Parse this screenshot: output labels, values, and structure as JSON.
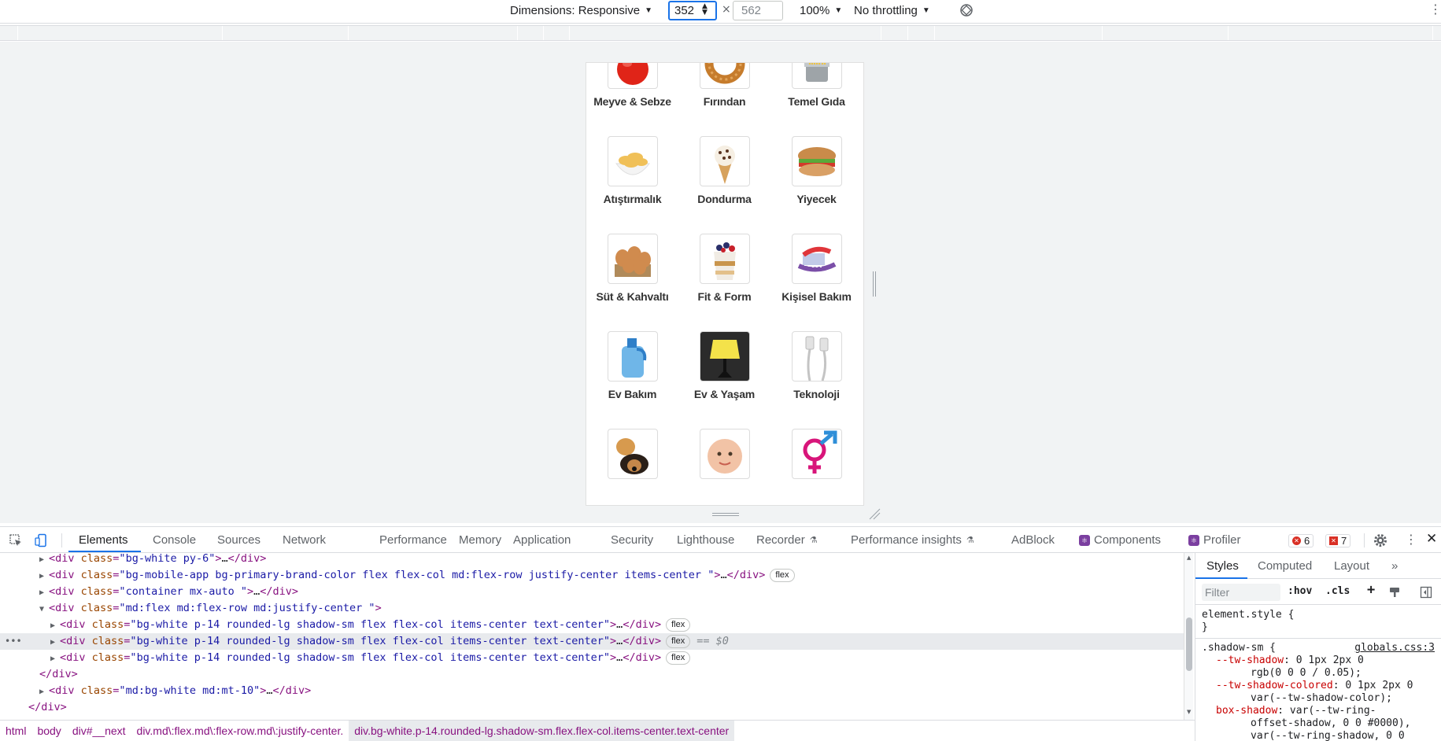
{
  "device_toolbar": {
    "dimensions_label": "Dimensions: Responsive",
    "width_value": "352",
    "times_sign": "×",
    "height_placeholder": "562",
    "zoom_label": "100%",
    "throttling_label": "No throttling",
    "dropdown_arrow": "▼",
    "more_icon": "⋮"
  },
  "categories": [
    {
      "label": "Meyve & Sebze",
      "icon": "tomato-icon"
    },
    {
      "label": "Fırından",
      "icon": "simit-icon"
    },
    {
      "label": "Temel Gıda",
      "icon": "pasta-icon"
    },
    {
      "label": "Atıştırmalık",
      "icon": "chips-icon"
    },
    {
      "label": "Dondurma",
      "icon": "ice-cream-icon"
    },
    {
      "label": "Yiyecek",
      "icon": "sandwich-icon"
    },
    {
      "label": "Süt & Kahvaltı",
      "icon": "eggs-icon"
    },
    {
      "label": "Fit & Form",
      "icon": "parfait-icon"
    },
    {
      "label": "Kişisel Bakım",
      "icon": "toothbrush-icon"
    },
    {
      "label": "Ev Bakım",
      "icon": "detergent-icon"
    },
    {
      "label": "Ev & Yaşam",
      "icon": "lamp-icon"
    },
    {
      "label": "Teknoloji",
      "icon": "cable-icon"
    },
    {
      "label": "",
      "icon": "pets-icon"
    },
    {
      "label": "",
      "icon": "baby-icon"
    },
    {
      "label": "",
      "icon": "gender-icon"
    }
  ],
  "devtools": {
    "tabs": [
      "Elements",
      "Console",
      "Sources",
      "Network",
      "Performance",
      "Memory",
      "Application",
      "Security",
      "Lighthouse",
      "Recorder",
      "Performance insights",
      "AdBlock",
      "Components",
      "Profiler"
    ],
    "errors_count": "6",
    "warnings_count": "7",
    "tree": [
      {
        "indent": 0,
        "open": false,
        "tag": "div",
        "class": "bg-white py-6",
        "collapsed": true,
        "flex": false
      },
      {
        "indent": 0,
        "open": false,
        "tag": "div",
        "class": "bg-mobile-app bg-primary-brand-color flex flex-col md:flex-row justify-center items-center ",
        "collapsed": true,
        "flex": true
      },
      {
        "indent": 0,
        "open": false,
        "tag": "div",
        "class": "container mx-auto ",
        "collapsed": true,
        "flex": false
      },
      {
        "indent": 0,
        "open": true,
        "tag": "div",
        "class": "md:flex md:flex-row md:justify-center ",
        "collapsed": false,
        "flex": false
      },
      {
        "indent": 1,
        "open": false,
        "tag": "div",
        "class": "bg-white p-14 rounded-lg shadow-sm flex flex-col items-center text-center",
        "collapsed": true,
        "flex": true
      },
      {
        "indent": 1,
        "open": false,
        "tag": "div",
        "class": "bg-white p-14 rounded-lg shadow-sm flex flex-col items-center text-center",
        "collapsed": true,
        "flex": true,
        "selected": true
      },
      {
        "indent": 1,
        "open": false,
        "tag": "div",
        "class": "bg-white p-14 rounded-lg shadow-sm flex flex-col items-center text-center",
        "collapsed": true,
        "flex": true
      },
      {
        "indent": 0,
        "close": true,
        "tag": "div"
      },
      {
        "indent": 0,
        "open": false,
        "tag": "div",
        "class": "md:bg-white md:mt-10",
        "collapsed": true,
        "flex": false
      },
      {
        "indent": -1,
        "close": true,
        "tag": "div"
      }
    ],
    "flex_badge": "flex",
    "selected_marker": "== $0",
    "breadcrumbs": [
      "html",
      "body",
      "div#__next",
      "div.md\\:flex.md\\:flex-row.md\\:justify-center.",
      "div.bg-white.p-14.rounded-lg.shadow-sm.flex.flex-col.items-center.text-center"
    ],
    "styles": {
      "tabs": [
        "Styles",
        "Computed",
        "Layout",
        "»"
      ],
      "filter_placeholder": "Filter",
      "hov": ":hov",
      "cls": ".cls",
      "element_style": "element.style {",
      "close_brace": "}",
      "shadow_selector": ".shadow-sm {",
      "source": "globals.css:3",
      "lines": [
        {
          "prop": "--tw-shadow",
          "val": ": 0 1px 2px 0"
        },
        {
          "prop": "",
          "val": "rgb(0 0 0 / 0.05);"
        },
        {
          "prop": "--tw-shadow-colored",
          "val": ": 0 1px 2px 0"
        },
        {
          "prop": "",
          "val": "var(--tw-shadow-color);"
        },
        {
          "prop": "box-shadow",
          "val": ": var(--tw-ring-"
        },
        {
          "prop": "",
          "val": "offset-shadow, 0 0 #0000),"
        },
        {
          "prop": "",
          "val": "var(--tw-ring-shadow, 0 0"
        }
      ]
    }
  }
}
